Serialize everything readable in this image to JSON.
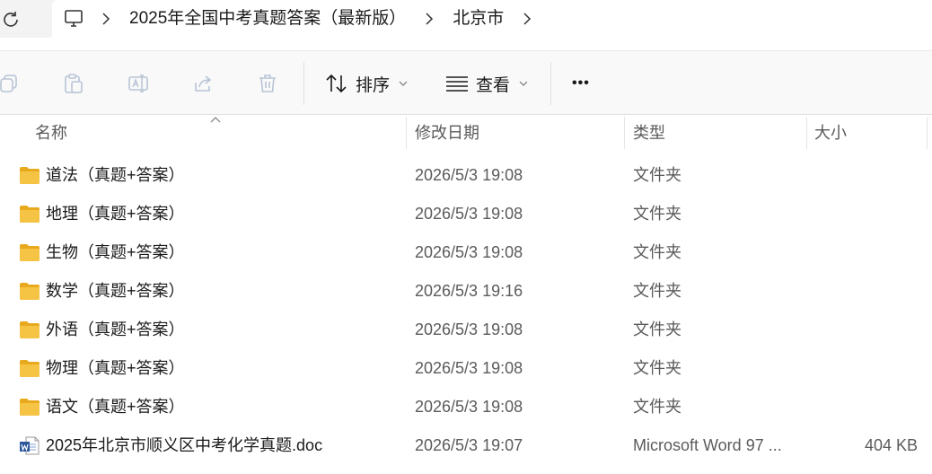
{
  "address": {
    "crumbs": [
      "2025年全国中考真题答案（最新版）",
      "北京市"
    ]
  },
  "toolbar": {
    "sort_label": "排序",
    "view_label": "查看",
    "more_label": "•••"
  },
  "columns": {
    "name": "名称",
    "modified": "修改日期",
    "type": "类型",
    "size": "大小"
  },
  "files": [
    {
      "icon": "folder-icon",
      "name": "道法（真题+答案）",
      "modified": "2026/5/3 19:08",
      "type": "文件夹",
      "size": ""
    },
    {
      "icon": "folder-icon",
      "name": "地理（真题+答案）",
      "modified": "2026/5/3 19:08",
      "type": "文件夹",
      "size": ""
    },
    {
      "icon": "folder-icon",
      "name": "生物（真题+答案）",
      "modified": "2026/5/3 19:08",
      "type": "文件夹",
      "size": ""
    },
    {
      "icon": "folder-icon",
      "name": "数学（真题+答案）",
      "modified": "2026/5/3 19:16",
      "type": "文件夹",
      "size": ""
    },
    {
      "icon": "folder-icon",
      "name": "外语（真题+答案）",
      "modified": "2026/5/3 19:08",
      "type": "文件夹",
      "size": ""
    },
    {
      "icon": "folder-icon",
      "name": "物理（真题+答案）",
      "modified": "2026/5/3 19:08",
      "type": "文件夹",
      "size": ""
    },
    {
      "icon": "folder-icon",
      "name": "语文（真题+答案）",
      "modified": "2026/5/3 19:08",
      "type": "文件夹",
      "size": ""
    },
    {
      "icon": "word-doc-icon",
      "name": "2025年北京市顺义区中考化学真题.doc",
      "modified": "2026/5/3 19:07",
      "type": "Microsoft Word 97 ...",
      "size": "404 KB"
    }
  ],
  "colors": {
    "folder": "#f6c445",
    "folder_dark": "#e8a91c",
    "word": "#2b579a"
  }
}
